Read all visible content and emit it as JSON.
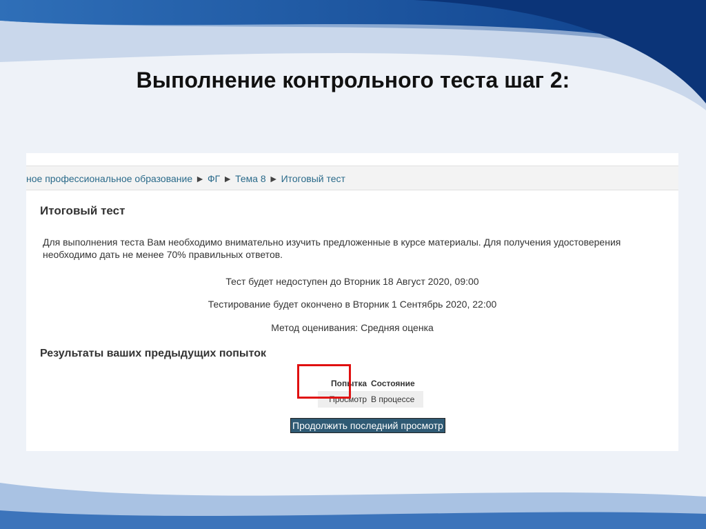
{
  "slide": {
    "title": "Выполнение контрольного теста шаг 2:"
  },
  "breadcrumb": [
    "ное профессиональное образование",
    "ФГ",
    "Тема 8",
    "Итоговый тест"
  ],
  "breadcrumb_sep": "►",
  "page": {
    "heading": "Итоговый тест",
    "description": "Для выполнения теста Вам необходимо внимательно изучить предложенные в курсе материалы. Для получения удостоверения необходимо дать не менее 70% правильных ответов.",
    "open_info": "Тест будет недоступен до Вторник 18 Август 2020, 09:00",
    "close_info": "Тестирование будет окончено в Вторник 1 Сентябрь 2020, 22:00",
    "grading": "Метод оценивания: Средняя оценка",
    "results_heading": "Результаты ваших предыдущих попыток",
    "table": {
      "headers": [
        "Попытка",
        "Состояние"
      ],
      "rows": [
        [
          "Просмотр",
          "В процессе"
        ]
      ]
    },
    "continue_button": "Продолжить последний просмотр"
  },
  "colors": {
    "link": "#2a6a8a",
    "button": "#2f5a74",
    "highlight": "#e01010"
  }
}
